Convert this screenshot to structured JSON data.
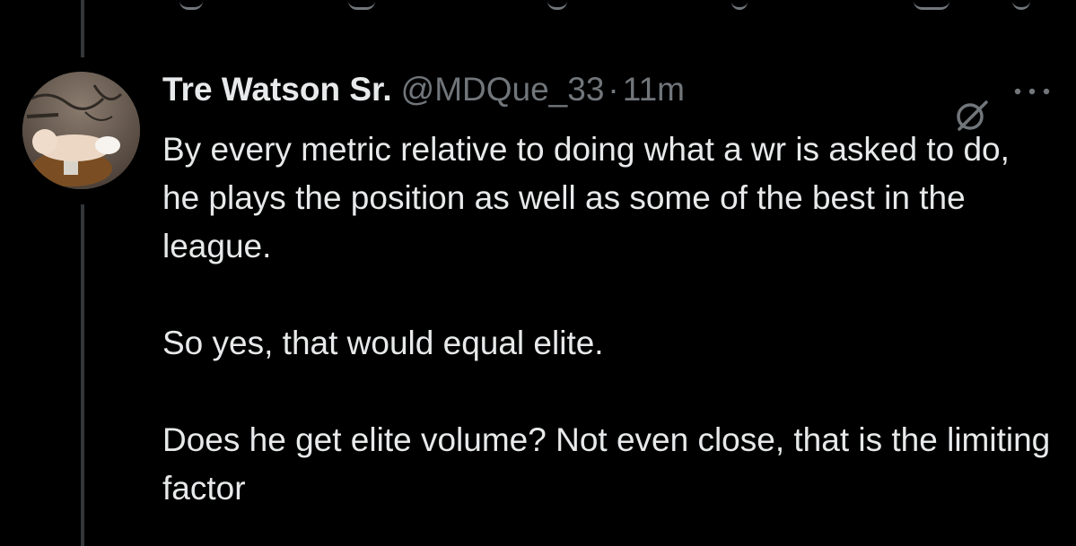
{
  "tweet": {
    "author": {
      "display_name": "Tre Watson Sr.",
      "handle": "@MDQue_33",
      "avatar_icon": "user-avatar"
    },
    "separator": "·",
    "timestamp": "11m",
    "paragraphs": [
      "By every metric relative to doing what a wr is asked to do, he plays the position as well as some of the best in the league.",
      "So yes, that would equal elite.",
      "Does he get elite volume? Not even close, that is the limiting factor"
    ],
    "icons": {
      "grok": "grok-slash-icon",
      "more": "more-options-icon"
    }
  },
  "theme": {
    "background": "#000000",
    "text_primary": "#e7e9ea",
    "text_secondary": "#71767b",
    "thread_line": "#333639"
  }
}
